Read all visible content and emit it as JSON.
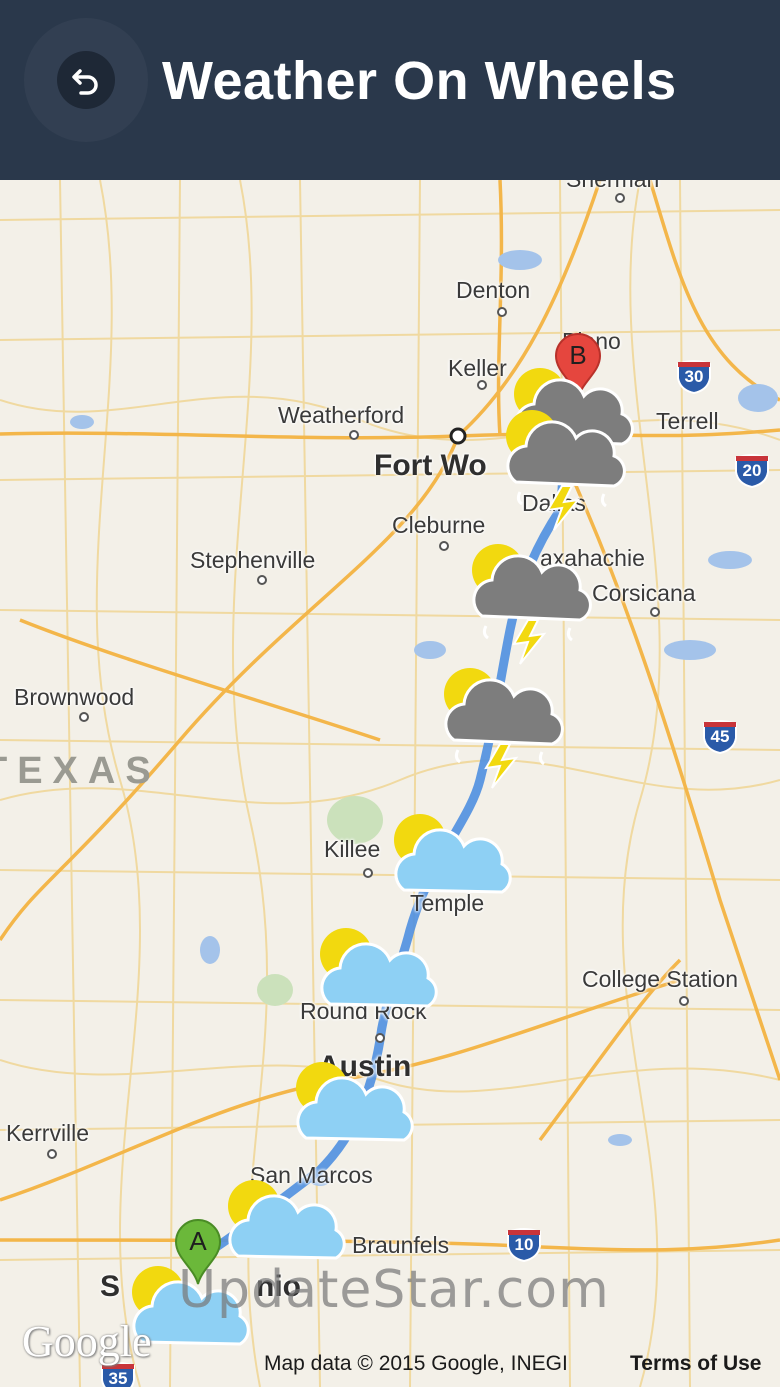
{
  "app": {
    "title": "Weather On Wheels",
    "back_icon": "back-arrow-icon"
  },
  "map": {
    "cities": {
      "sherman": "Sherman",
      "denton": "Denton",
      "plano": "Plano",
      "keller": "Keller",
      "weatherford": "Weatherford",
      "fort_worth": "Fort Wo",
      "dallas": "Dallas",
      "terrell": "Terrell",
      "cleburne": "Cleburne",
      "stephenville": "Stephenville",
      "waxahachie": "axahachie",
      "corsicana": "Corsicana",
      "brownwood": "Brownwood",
      "killeen": "Killee",
      "temple": "Temple",
      "college_station": "College Station",
      "round_rock": "Round Rock",
      "austin": "Austin",
      "kerrville": "Kerrville",
      "san_marcos": "San Marcos",
      "new_braunfels": "Braunfels",
      "san_antonio_a": "S",
      "san_antonio_b": "nio"
    },
    "state_label": "TEXAS",
    "shields": {
      "i30": "30",
      "i20": "20",
      "i45": "45",
      "i10": "10",
      "i35": "35"
    },
    "markers": {
      "start": "A",
      "end": "B"
    },
    "weather_icons": [
      "thunderstorm-icon",
      "thunderstorm-icon",
      "thunderstorm-icon",
      "thunderstorm-icon",
      "partly-cloudy-icon",
      "partly-cloudy-icon",
      "partly-cloudy-icon",
      "partly-cloudy-icon",
      "partly-cloudy-icon"
    ],
    "route_color": "#5a9be6",
    "watermark": "UpdateStar.com",
    "google_logo": "Google",
    "attribution": "Map data © 2015 Google, INEGI",
    "terms": "Terms of Use"
  }
}
